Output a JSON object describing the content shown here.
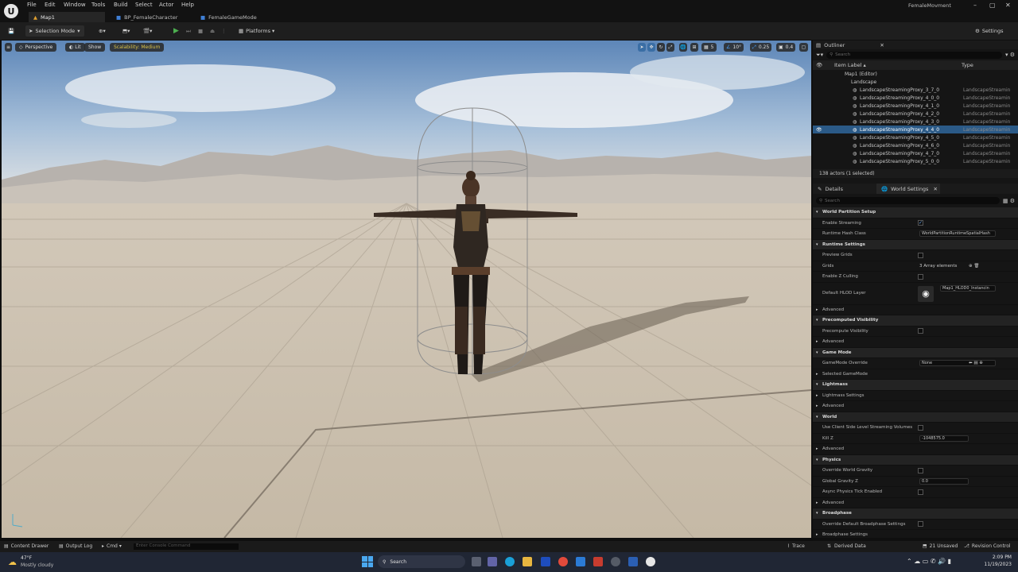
{
  "title_bar": {
    "project_name": "FemaleMovment",
    "menus": [
      "File",
      "Edit",
      "Window",
      "Tools",
      "Build",
      "Select",
      "Actor",
      "Help"
    ],
    "tabs": [
      "Map1",
      "BP_FemaleCharacter",
      "FemaleGameMode"
    ]
  },
  "toolbar": {
    "selection_mode": "Selection Mode",
    "platforms": "Platforms",
    "settings": "Settings"
  },
  "viewport": {
    "perspective": "Perspective",
    "lit": "Lit",
    "show": "Show",
    "scalability": "Scalability: Medium",
    "grid_size": "5",
    "rotation_snap": "10°",
    "scale_snap": "0.25",
    "camera_speed": "0.4"
  },
  "outliner": {
    "title": "Outliner",
    "search_placeholder": "Search",
    "col_label": "Item Label ▴",
    "col_type": "Type",
    "tree_root": "Map1 (Editor)",
    "tree_folder": "Landscape",
    "rows": [
      {
        "label": "LandscapeStreamingProxy_3_7_0",
        "type": "LandscapeStreamin"
      },
      {
        "label": "LandscapeStreamingProxy_4_0_0",
        "type": "LandscapeStreamin"
      },
      {
        "label": "LandscapeStreamingProxy_4_1_0",
        "type": "LandscapeStreamin"
      },
      {
        "label": "LandscapeStreamingProxy_4_2_0",
        "type": "LandscapeStreamin"
      },
      {
        "label": "LandscapeStreamingProxy_4_3_0",
        "type": "LandscapeStreamin"
      },
      {
        "label": "LandscapeStreamingProxy_4_4_0",
        "type": "LandscapeStreamin"
      },
      {
        "label": "LandscapeStreamingProxy_4_5_0",
        "type": "LandscapeStreamin"
      },
      {
        "label": "LandscapeStreamingProxy_4_6_0",
        "type": "LandscapeStreamin"
      },
      {
        "label": "LandscapeStreamingProxy_4_7_0",
        "type": "LandscapeStreamin"
      },
      {
        "label": "LandscapeStreamingProxy_5_0_0",
        "type": "LandscapeStreamin"
      }
    ],
    "selected_index": 5,
    "count": "138 actors (1 selected)"
  },
  "details": {
    "tab_details": "Details",
    "tab_world_settings": "World Settings",
    "search_placeholder": "Search",
    "rows": [
      {
        "kind": "cat",
        "label": "World Partition Setup"
      },
      {
        "kind": "check",
        "label": "Enable Streaming",
        "checked": true
      },
      {
        "kind": "combo",
        "label": "Runtime Hash Class",
        "value": "WorldPartitionRuntimeSpatialHash"
      },
      {
        "kind": "cat",
        "label": "Runtime Settings"
      },
      {
        "kind": "check",
        "label": "Preview Grids",
        "checked": false
      },
      {
        "kind": "text",
        "label": "Grids",
        "value": "3 Array elements"
      },
      {
        "kind": "check",
        "label": "Enable Z Culling",
        "checked": false
      },
      {
        "kind": "hlod",
        "label": "Default HLOD Layer",
        "value": "Map1_HLOD0_Instancin"
      },
      {
        "kind": "sub",
        "label": "Advanced"
      },
      {
        "kind": "cat",
        "label": "Precomputed Visibility"
      },
      {
        "kind": "check",
        "label": "Precompute Visibility",
        "checked": false
      },
      {
        "kind": "sub",
        "label": "Advanced"
      },
      {
        "kind": "cat",
        "label": "Game Mode"
      },
      {
        "kind": "combo",
        "label": "GameMode Override",
        "value": "None"
      },
      {
        "kind": "sub",
        "label": "Selected GameMode"
      },
      {
        "kind": "cat",
        "label": "Lightmass"
      },
      {
        "kind": "sub",
        "label": "Lightmass Settings"
      },
      {
        "kind": "sub",
        "label": "Advanced"
      },
      {
        "kind": "cat",
        "label": "World"
      },
      {
        "kind": "check",
        "label": "Use Client Side Level Streaming Volumes",
        "checked": false
      },
      {
        "kind": "input",
        "label": "Kill Z",
        "value": "-1048575.0"
      },
      {
        "kind": "sub",
        "label": "Advanced"
      },
      {
        "kind": "cat",
        "label": "Physics"
      },
      {
        "kind": "check",
        "label": "Override World Gravity",
        "checked": false
      },
      {
        "kind": "input",
        "label": "Global Gravity Z",
        "value": "0.0"
      },
      {
        "kind": "check",
        "label": "Async Physics Tick Enabled",
        "checked": false
      },
      {
        "kind": "sub",
        "label": "Advanced"
      },
      {
        "kind": "cat",
        "label": "Broadphase"
      },
      {
        "kind": "check",
        "label": "Override Default Broadphase Settings",
        "checked": false
      },
      {
        "kind": "sub",
        "label": "Broadphase Settings"
      }
    ]
  },
  "status_bar": {
    "content_drawer": "Content Drawer",
    "output_log": "Output Log",
    "cmd": "Cmd",
    "console_placeholder": "Enter Console Command",
    "trace": "Trace",
    "derived_data": "Derived Data",
    "unsaved": "21 Unsaved",
    "revision_control": "Revision Control"
  },
  "taskbar": {
    "temperature": "47°F",
    "weather": "Mostly cloudy",
    "search": "Search",
    "time": "2:09 PM",
    "date": "11/19/2023"
  },
  "colors": {
    "selection_blue": "#2b5a87",
    "accent_yellow": "#d9c14a",
    "play_green": "#4caf50"
  }
}
